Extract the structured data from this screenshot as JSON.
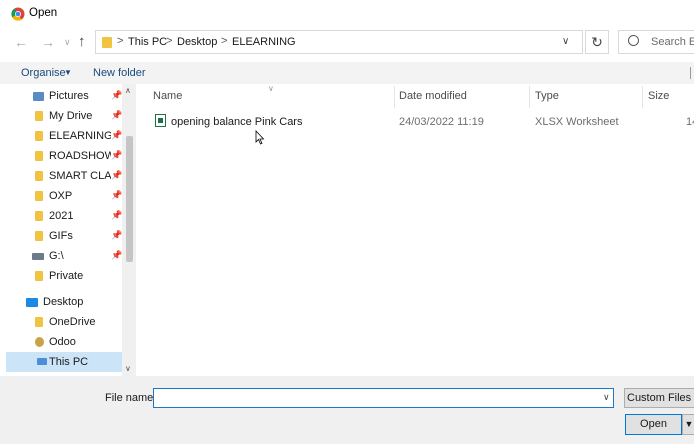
{
  "window": {
    "title": "Open"
  },
  "address": {
    "crumbs": [
      "This PC",
      "Desktop",
      "ELEARNING"
    ],
    "separator": ">"
  },
  "search": {
    "placeholder": "Search EL"
  },
  "toolbar": {
    "organise_label": "Organise",
    "new_folder_label": "New folder"
  },
  "nav": {
    "items": [
      {
        "label": "Pictures",
        "icon": "pictures-icon",
        "pinned": true
      },
      {
        "label": "My Drive",
        "icon": "folder-icon",
        "pinned": true
      },
      {
        "label": "ELEARNING",
        "icon": "folder-icon",
        "pinned": true
      },
      {
        "label": "ROADSHOW",
        "icon": "folder-icon",
        "pinned": true
      },
      {
        "label": "SMART CLASS",
        "icon": "folder-icon",
        "pinned": true
      },
      {
        "label": "OXP",
        "icon": "folder-icon",
        "pinned": true
      },
      {
        "label": "2021",
        "icon": "folder-icon",
        "pinned": true
      },
      {
        "label": "GIFs",
        "icon": "folder-icon",
        "pinned": true
      },
      {
        "label": "G:\\",
        "icon": "drive-icon",
        "pinned": true
      },
      {
        "label": "Private",
        "icon": "folder-icon",
        "pinned": false
      },
      {
        "label": "Desktop",
        "icon": "desktop-icon",
        "pinned": false
      },
      {
        "label": "OneDrive",
        "icon": "folder-icon",
        "pinned": false
      },
      {
        "label": "Odoo",
        "icon": "user-icon",
        "pinned": false
      },
      {
        "label": "This PC",
        "icon": "computer-icon",
        "pinned": false,
        "selected": true
      }
    ]
  },
  "columns": {
    "name": "Name",
    "date": "Date modified",
    "type": "Type",
    "size": "Size"
  },
  "files": [
    {
      "name": "opening balance Pink Cars",
      "date": "24/03/2022 11:19",
      "type": "XLSX Worksheet",
      "size": "14"
    }
  ],
  "bottom": {
    "file_name_label": "File name:",
    "file_name_value": "",
    "filter_label": "Custom Files",
    "open_label": "Open"
  },
  "colors": {
    "accent": "#0078d7",
    "folder": "#f0c442",
    "selection": "#cce4f7"
  }
}
